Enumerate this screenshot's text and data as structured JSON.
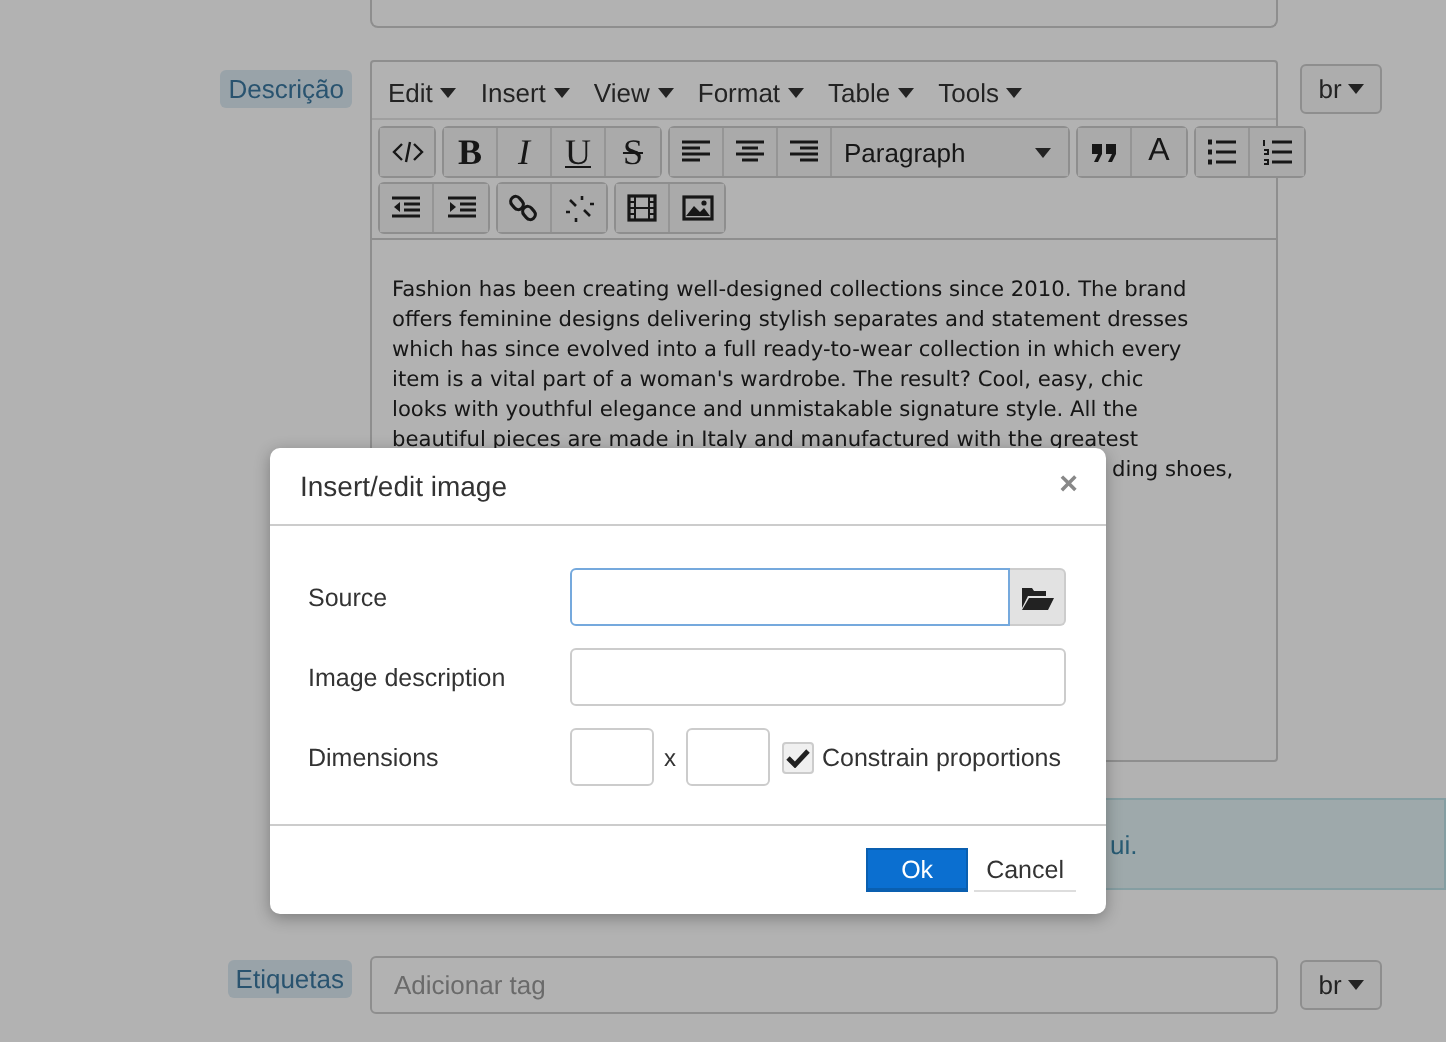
{
  "form": {
    "description_label": "Descrição",
    "editor": {
      "menu": [
        "Edit",
        "Insert",
        "View",
        "Format",
        "Table",
        "Tools"
      ],
      "toolbar": {
        "glyphs": [
          "B",
          "I",
          "U",
          "S",
          "A"
        ],
        "block_format": "Paragraph"
      },
      "content_lines": [
        "Fashion has been creating well-designed collections since 2010. The brand",
        "offers feminine designs delivering stylish separates and statement dresses",
        "which has since evolved into a full ready-to-wear collection in which every",
        "item is a vital part of a woman's wardrobe. The result? Cool, easy, chic",
        "looks with youthful elegance and unmistakable signature style. All the",
        "beautiful pieces are made in Italy and manufactured with the greatest"
      ],
      "content_fragment": "ding shoes,"
    },
    "lang_button": "br",
    "notice_fragment": "ui.",
    "tags_label": "Etiquetas",
    "tags_placeholder": "Adicionar tag",
    "tags_lang_button": "br"
  },
  "dialog": {
    "title": "Insert/edit image",
    "close": "×",
    "fields": [
      {
        "label": "Source",
        "kind": "browse",
        "focused": true
      },
      {
        "label": "Image description",
        "kind": "text",
        "focused": false
      },
      {
        "label": "Dimensions",
        "kind": "size",
        "separator": "x",
        "checkbox": {
          "label": "Constrain proportions",
          "checked": true
        }
      }
    ],
    "buttons": [
      {
        "label": "Ok",
        "primary": true
      },
      {
        "label": "Cancel",
        "primary": false
      }
    ]
  }
}
